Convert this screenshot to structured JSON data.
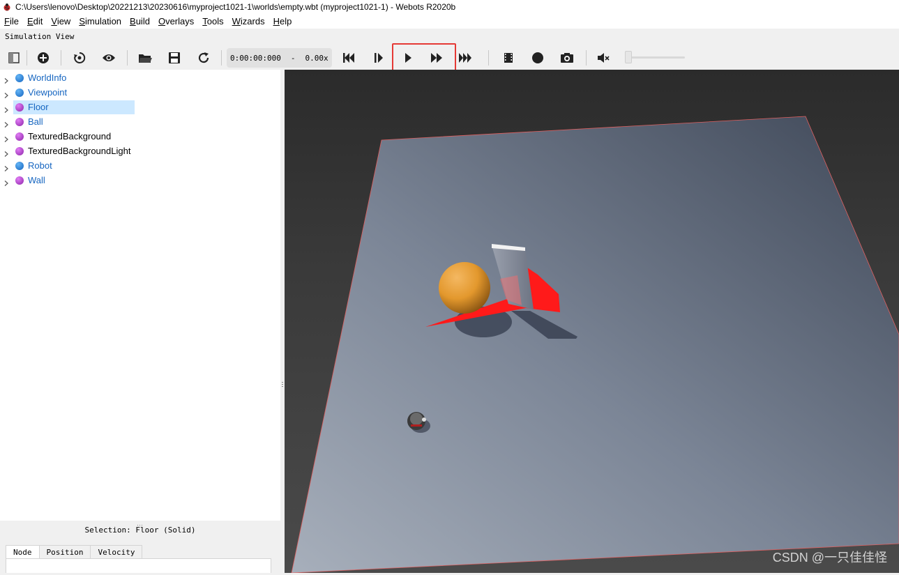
{
  "window": {
    "title": "C:\\Users\\lenovo\\Desktop\\20221213\\20230616\\myproject1021-1\\worlds\\empty.wbt (myproject1021-1) - Webots R2020b",
    "app_icon": "ladybug-icon"
  },
  "menu": [
    {
      "label": "File",
      "u": "F",
      "rest": "ile"
    },
    {
      "label": "Edit",
      "u": "E",
      "rest": "dit"
    },
    {
      "label": "View",
      "u": "V",
      "rest": "iew"
    },
    {
      "label": "Simulation",
      "u": "S",
      "rest": "imulation"
    },
    {
      "label": "Build",
      "u": "B",
      "rest": "uild"
    },
    {
      "label": "Overlays",
      "u": "O",
      "rest": "verlays"
    },
    {
      "label": "Tools",
      "u": "T",
      "rest": "ools"
    },
    {
      "label": "Wizards",
      "u": "W",
      "rest": "izards"
    },
    {
      "label": "Help",
      "u": "H",
      "rest": "elp"
    }
  ],
  "simulation_view_label": "Simulation View",
  "toolbar": {
    "time": "0:00:00:000",
    "dash": "-",
    "speed": "0.00x",
    "buttons": [
      "toggle-scene-tree-icon",
      "add-node-icon",
      "reset-viewpoint-icon",
      "view-icon",
      "open-world-icon",
      "save-world-icon",
      "reload-world-icon",
      "reset-simulation-icon",
      "step-icon",
      "play-icon",
      "fast-icon",
      "fastest-icon",
      "record-movie-icon",
      "record-icon",
      "screenshot-icon",
      "mute-icon"
    ],
    "highlighted": [
      "play-icon",
      "fast-icon"
    ],
    "highlight_color": "#e53935",
    "volume_level": 0.0
  },
  "scene_tree": {
    "items": [
      {
        "label": "WorldInfo",
        "color": "#1565c0",
        "ball": "blue",
        "selected": false
      },
      {
        "label": "Viewpoint",
        "color": "#1565c0",
        "ball": "blue",
        "selected": false
      },
      {
        "label": "Floor",
        "color": "#1565c0",
        "ball": "purple",
        "selected": true
      },
      {
        "label": "Ball",
        "color": "#1565c0",
        "ball": "purple",
        "selected": false
      },
      {
        "label": "TexturedBackground",
        "color": "#000000",
        "ball": "purple",
        "selected": false
      },
      {
        "label": "TexturedBackgroundLight",
        "color": "#000000",
        "ball": "purple",
        "selected": false
      },
      {
        "label": "Robot",
        "color": "#1565c0",
        "ball": "blue",
        "selected": false
      },
      {
        "label": "Wall",
        "color": "#1565c0",
        "ball": "purple",
        "selected": false
      }
    ]
  },
  "selection": {
    "text": "Selection: Floor (Solid)",
    "tabs": [
      "Node",
      "Position",
      "Velocity"
    ],
    "active_tab": "Node"
  },
  "watermark": "CSDN @一只佳佳怪"
}
